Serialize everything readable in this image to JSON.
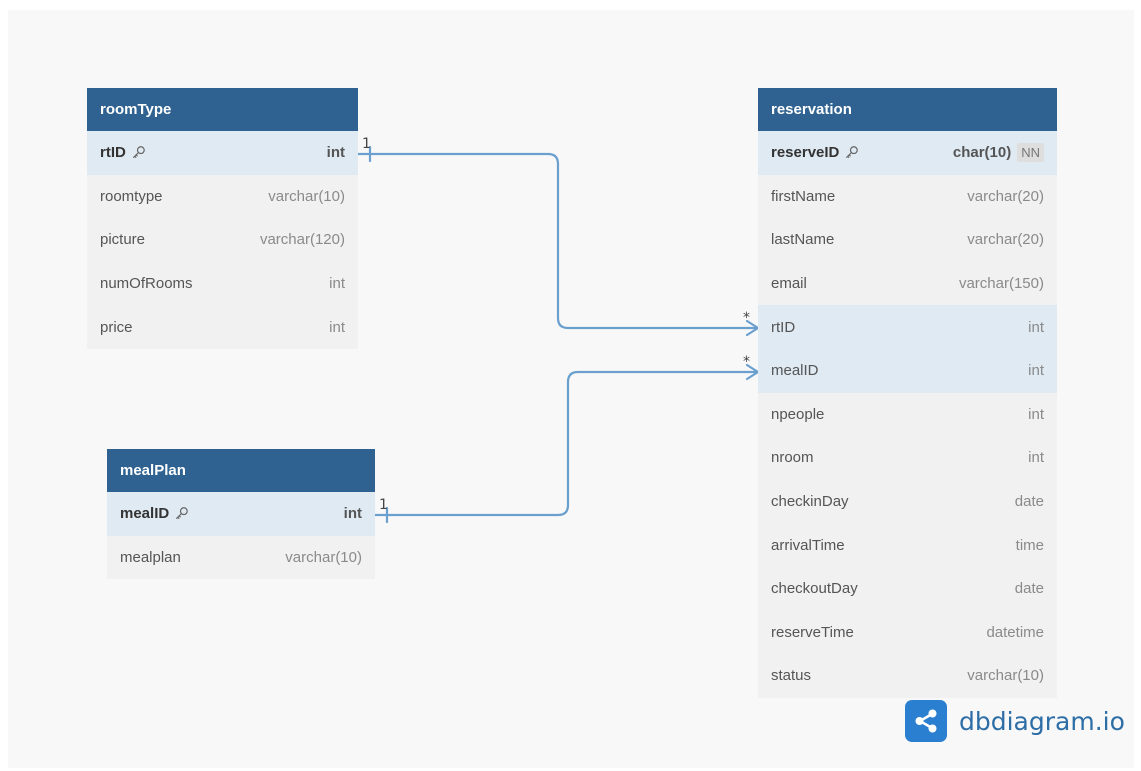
{
  "tables": {
    "roomType": {
      "name": "roomType",
      "fields": [
        {
          "name": "rtID",
          "type": "int"
        },
        {
          "name": "roomtype",
          "type": "varchar(10)"
        },
        {
          "name": "picture",
          "type": "varchar(120)"
        },
        {
          "name": "numOfRooms",
          "type": "int"
        },
        {
          "name": "price",
          "type": "int"
        }
      ]
    },
    "mealPlan": {
      "name": "mealPlan",
      "fields": [
        {
          "name": "mealID",
          "type": "int"
        },
        {
          "name": "mealplan",
          "type": "varchar(10)"
        }
      ]
    },
    "reservation": {
      "name": "reservation",
      "fields": [
        {
          "name": "reserveID",
          "type": "char(10)",
          "badge": "NN"
        },
        {
          "name": "firstName",
          "type": "varchar(20)"
        },
        {
          "name": "lastName",
          "type": "varchar(20)"
        },
        {
          "name": "email",
          "type": "varchar(150)"
        },
        {
          "name": "rtID",
          "type": "int"
        },
        {
          "name": "mealID",
          "type": "int"
        },
        {
          "name": "npeople",
          "type": "int"
        },
        {
          "name": "nroom",
          "type": "int"
        },
        {
          "name": "checkinDay",
          "type": "date"
        },
        {
          "name": "arrivalTime",
          "type": "time"
        },
        {
          "name": "checkoutDay",
          "type": "date"
        },
        {
          "name": "reserveTime",
          "type": "datetime"
        },
        {
          "name": "status",
          "type": "varchar(10)"
        }
      ]
    }
  },
  "relationships": [
    {
      "from": "roomType.rtID",
      "to": "reservation.rtID",
      "from_card": "1",
      "to_card": "*"
    },
    {
      "from": "mealPlan.mealID",
      "to": "reservation.mealID",
      "from_card": "1",
      "to_card": "*"
    }
  ],
  "brand": {
    "name": "dbdiagram.io"
  },
  "colors": {
    "header": "#2f6290",
    "edge": "#6a9fce",
    "brand": "#2b7fd0"
  },
  "icons": {
    "primary_key": "key-icon",
    "logo": "share-icon"
  }
}
